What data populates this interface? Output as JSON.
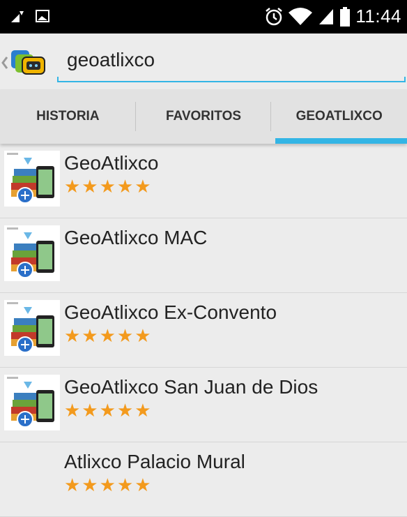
{
  "status_bar": {
    "time": "11:44",
    "icons": [
      "signal-icon",
      "image-icon",
      "alarm-icon",
      "wifi-icon",
      "cell-signal-icon",
      "battery-icon"
    ]
  },
  "search": {
    "value": "geoatlixco"
  },
  "tabs": [
    {
      "label": "HISTORIA",
      "active": false
    },
    {
      "label": "FAVORITOS",
      "active": false
    },
    {
      "label": "GEOATLIXCO",
      "active": true
    }
  ],
  "results": [
    {
      "title": "GeoAtlixco",
      "rating": 5,
      "stars": "★★★★★",
      "has_thumb": true
    },
    {
      "title": "GeoAtlixco MAC",
      "rating": 0,
      "stars": "",
      "has_thumb": true
    },
    {
      "title": "GeoAtlixco Ex-Convento",
      "rating": 5,
      "stars": "★★★★★",
      "has_thumb": true
    },
    {
      "title": "GeoAtlixco San Juan de Dios",
      "rating": 5,
      "stars": "★★★★★",
      "has_thumb": true
    },
    {
      "title": "Atlixco Palacio Mural",
      "rating": 5,
      "stars": "★★★★★",
      "has_thumb": false
    }
  ],
  "colors": {
    "accent": "#33b5e5",
    "star": "#f39a1d",
    "background": "#ececec"
  }
}
